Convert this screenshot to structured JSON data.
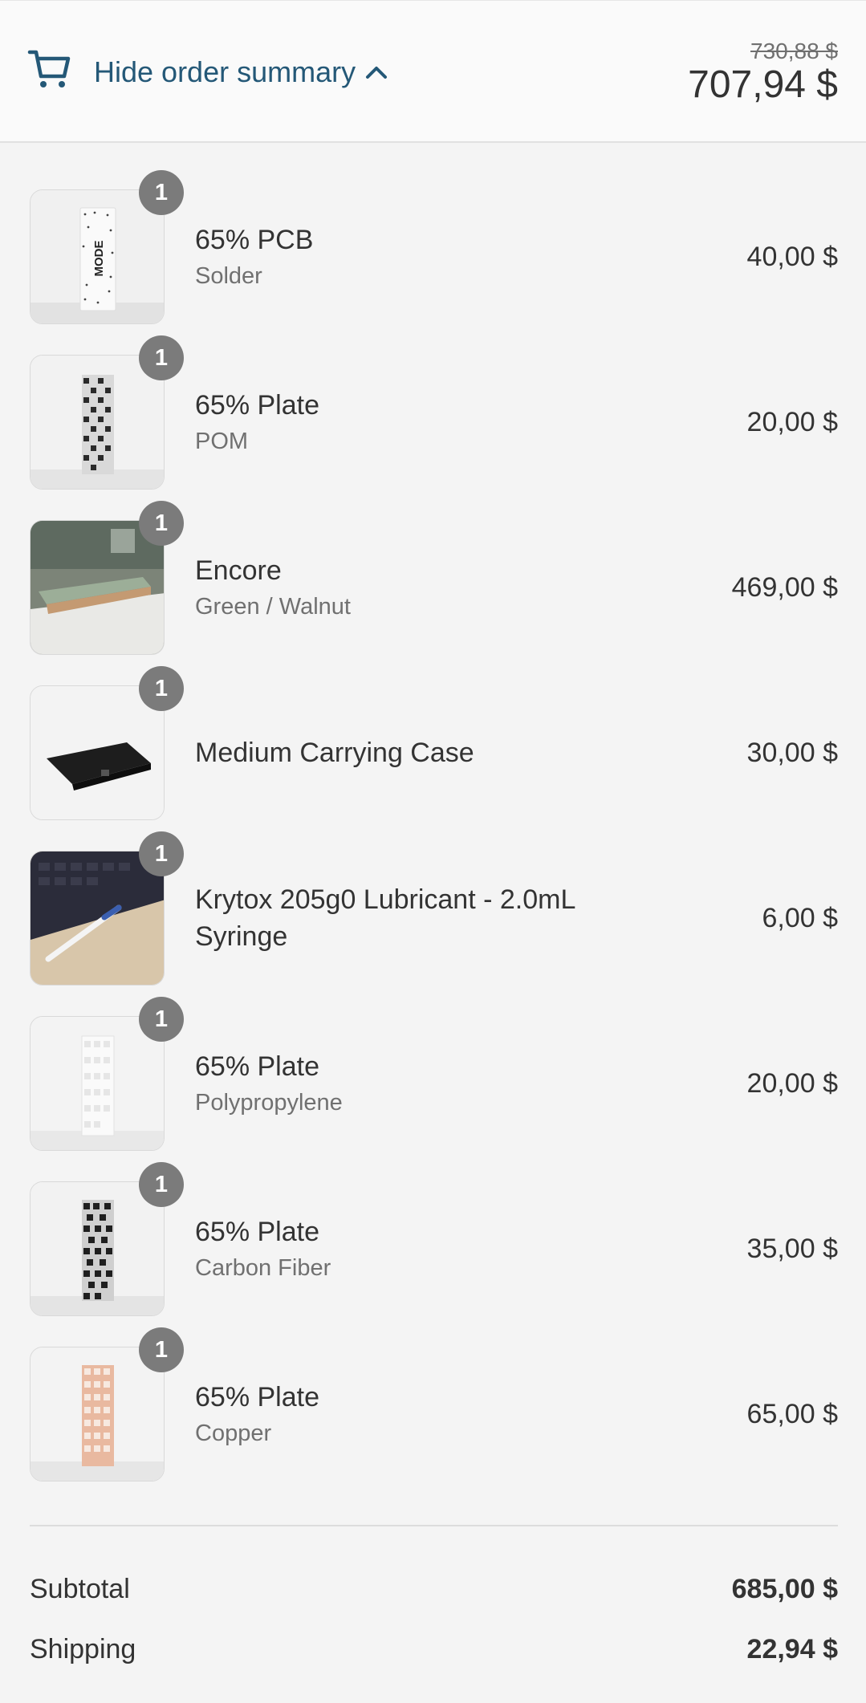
{
  "header": {
    "toggle_label": "Hide order summary",
    "old_total": "730,88 $",
    "total": "707,94 $",
    "icons": [
      "cart-icon",
      "chevron-up-icon"
    ]
  },
  "items": [
    {
      "name": "65% PCB",
      "variant": "Solder",
      "price": "40,00 $",
      "quantity": "1"
    },
    {
      "name": "65% Plate",
      "variant": "POM",
      "price": "20,00 $",
      "quantity": "1"
    },
    {
      "name": "Encore",
      "variant": "Green / Walnut",
      "price": "469,00 $",
      "quantity": "1"
    },
    {
      "name": "Medium Carrying Case",
      "variant": "",
      "price": "30,00 $",
      "quantity": "1"
    },
    {
      "name": "Krytox 205g0 Lubricant - 2.0mL Syringe",
      "variant": "",
      "price": "6,00 $",
      "quantity": "1"
    },
    {
      "name": "65% Plate",
      "variant": "Polypropylene",
      "price": "20,00 $",
      "quantity": "1"
    },
    {
      "name": "65% Plate",
      "variant": "Carbon Fiber",
      "price": "35,00 $",
      "quantity": "1"
    },
    {
      "name": "65% Plate",
      "variant": "Copper",
      "price": "65,00 $",
      "quantity": "1"
    }
  ],
  "summary": {
    "subtotal_label": "Subtotal",
    "subtotal_value": "685,00 $",
    "shipping_label": "Shipping",
    "shipping_value": "22,94 $"
  },
  "colors": {
    "link": "#245877",
    "badge": "#7b7b7b",
    "text": "#333333",
    "muted": "#707070",
    "background": "#f4f4f4"
  }
}
